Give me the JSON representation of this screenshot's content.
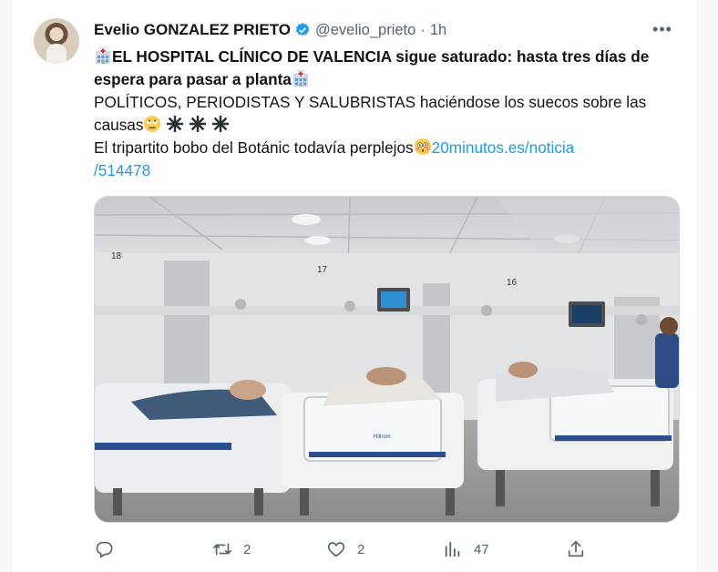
{
  "tweet": {
    "author_name": "Evelio GONZALEZ PRIETO",
    "handle": "@evelio_prieto",
    "separator": "·",
    "time": "1h",
    "more_label": "•••",
    "line1_bold": "EL HOSPITAL CLÍNICO DE VALENCIA sigue saturado: hasta tres días de espera para pasar a planta",
    "line2": "POLÍTICOS, PERIODISTAS Y SALUBRISTAS haciéndose los suecos sobre las causas",
    "line3": "El tripartito bobo del Botánic todavía perplejos",
    "link": "20minutos.es/noticia/514478",
    "link_part1": "20minutos.es/noticia",
    "link_part2": "/514478",
    "emojis": [
      "hospital-emoji",
      "hospital-emoji",
      "face-with-rolling-eyes-emoji",
      "eight-pointed-star-emoji",
      "eight-pointed-star-emoji",
      "eight-pointed-star-emoji",
      "flushed-face-emoji"
    ],
    "image_bed_numbers": [
      "18",
      "17",
      "16"
    ],
    "image_bed_brand": "Hillrom"
  },
  "actions": {
    "reply_count": "",
    "retweet_count": "2",
    "like_count": "2",
    "views_count": "47"
  },
  "colors": {
    "link": "#1d9bf0",
    "verified": "#1d9bf0",
    "muted": "#536471",
    "text": "#0f1419"
  }
}
